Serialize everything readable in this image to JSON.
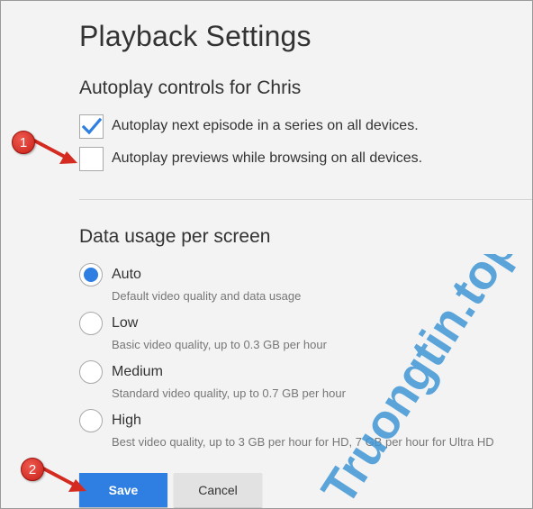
{
  "page": {
    "title": "Playback Settings"
  },
  "autoplay": {
    "heading": "Autoplay controls for Chris",
    "options": [
      {
        "label": "Autoplay next episode in a series on all devices.",
        "checked": true
      },
      {
        "label": "Autoplay previews while browsing on all devices.",
        "checked": false
      }
    ]
  },
  "data_usage": {
    "heading": "Data usage per screen",
    "selected": "Auto",
    "options": [
      {
        "label": "Auto",
        "desc": "Default video quality and data usage"
      },
      {
        "label": "Low",
        "desc": "Basic video quality, up to 0.3 GB per hour"
      },
      {
        "label": "Medium",
        "desc": "Standard video quality, up to 0.7 GB per hour"
      },
      {
        "label": "High",
        "desc": "Best video quality, up to 3 GB per hour for HD, 7 GB per hour for Ultra HD"
      }
    ]
  },
  "buttons": {
    "save_label": "Save",
    "cancel_label": "Cancel"
  },
  "annotations": {
    "callout1": "1",
    "callout2": "2"
  },
  "watermark": {
    "text": "Truongtin.top"
  },
  "colors": {
    "accent": "#2f7fe3",
    "callout": "#d42a20",
    "watermark": "#3f95d4"
  }
}
